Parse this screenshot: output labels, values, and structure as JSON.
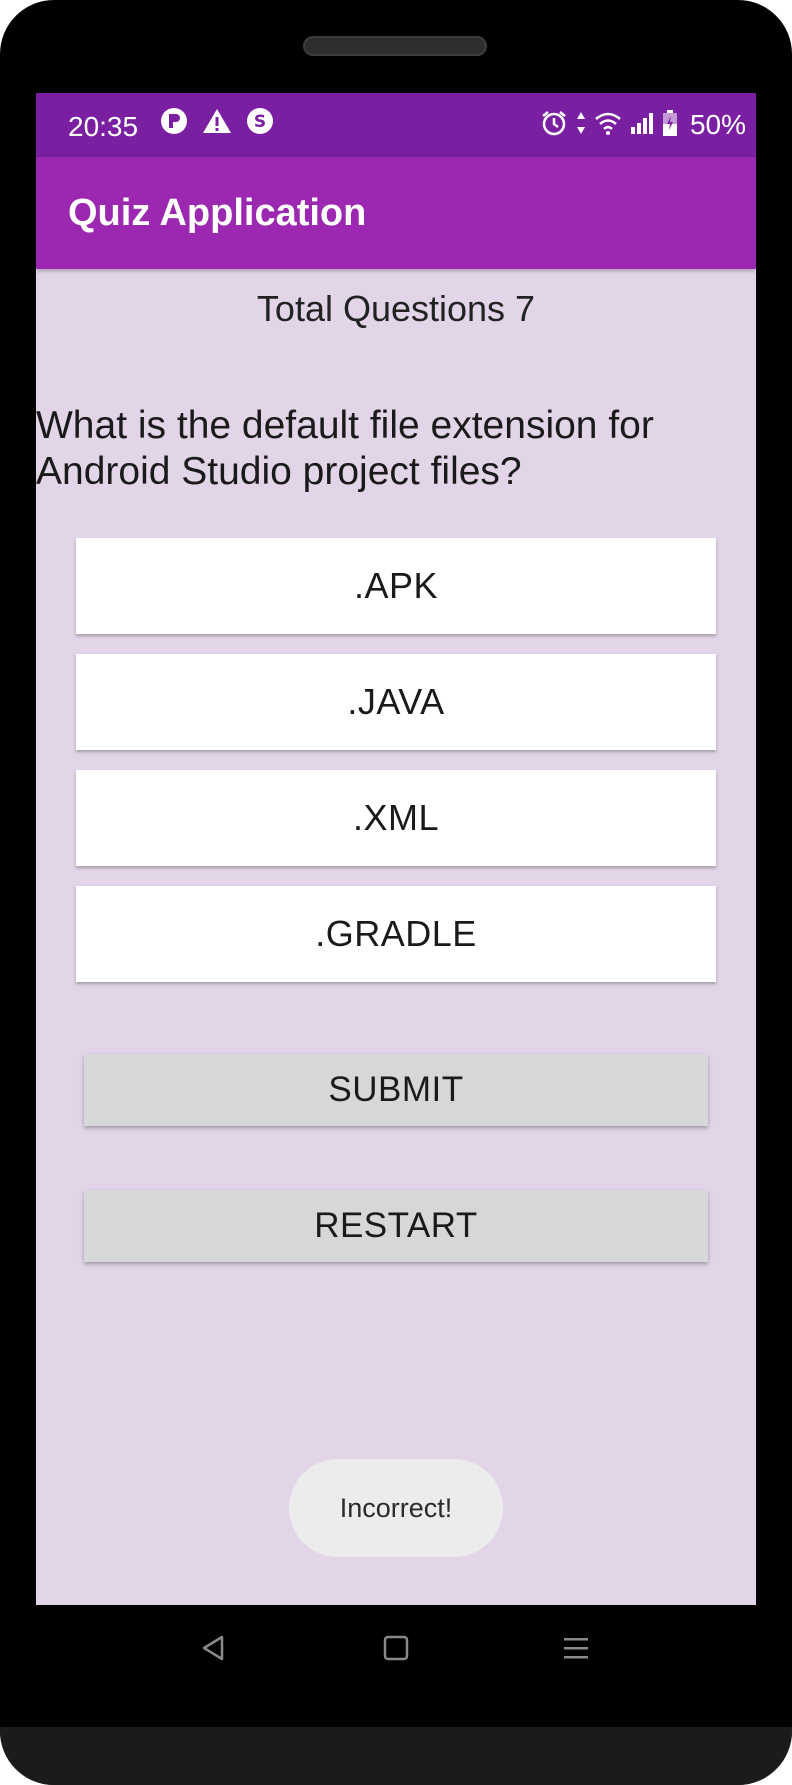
{
  "status_bar": {
    "time": "20:35",
    "battery": "50%",
    "left_icons": [
      "p-app-icon",
      "warning-icon",
      "s-app-icon"
    ],
    "right_icons": [
      "alarm-icon",
      "data-arrows-icon",
      "wifi-icon",
      "signal-icon",
      "battery-icon"
    ]
  },
  "app_bar": {
    "title": "Quiz Application"
  },
  "quiz": {
    "total_questions_label": "Total Questions 7",
    "question": "What is the default file extension for Android Studio project files?",
    "options": [
      ".APK",
      ".JAVA",
      ".XML",
      ".GRADLE"
    ],
    "submit_label": "SUBMIT",
    "restart_label": "RESTART"
  },
  "toast": {
    "message": "Incorrect!"
  },
  "nav_bar": {
    "buttons": [
      "back-icon",
      "home-icon",
      "menu-icon"
    ]
  },
  "colors": {
    "status_bar": "#7a1fa2",
    "app_bar": "#9c27b0",
    "background": "#e2d5e8",
    "option_bg": "#ffffff",
    "action_button_bg": "#d6d7d7",
    "toast_bg": "#ececec"
  }
}
